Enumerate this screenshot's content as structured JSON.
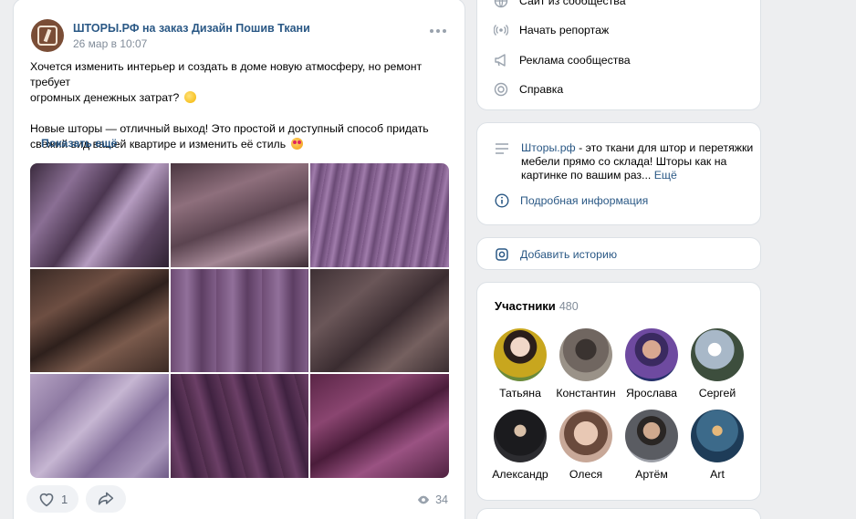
{
  "post": {
    "author": "ШТОРЫ.РФ на заказ Дизайн Пошив Ткани",
    "date": "26 мар в 10:07",
    "text_line1": "Хочется изменить интерьер и создать в доме новую атмосферу, но ремонт требует",
    "text_line2": "огромных денежных затрат?",
    "text_line3": "Новые шторы — отличный выход! Это простой и доступный способ придать",
    "text_line4": "свежий вид вашей квартире и изменить её стиль",
    "show_more": "Показать ещё",
    "photos": [
      "purple satin drape",
      "mauve tulle",
      "crinkled violet fabric",
      "brown silk",
      "lilac curtain folds",
      "taupe crumpled fabric",
      "lavender satin",
      "plum velvet curtain",
      "wine velvet"
    ],
    "likes": "1",
    "views": "34"
  },
  "menu": {
    "items": [
      {
        "label": "Сайт из сообщества",
        "icon": "globe-icon"
      },
      {
        "label": "Начать репортаж",
        "icon": "broadcast-icon"
      },
      {
        "label": "Реклама сообщества",
        "icon": "megaphone-icon"
      },
      {
        "label": "Справка",
        "icon": "help-icon"
      }
    ]
  },
  "description": {
    "link": "Шторы.рф",
    "text": " - это ткани для штор и перетяжки мебели прямо со склада! Шторы как на картинке по вашим раз...",
    "more": "Ещё",
    "details": "Подробная информация"
  },
  "story": {
    "label": "Добавить историю"
  },
  "members": {
    "title": "Участники",
    "count": "480",
    "list": [
      {
        "name": "Татьяна"
      },
      {
        "name": "Константин"
      },
      {
        "name": "Ярослава"
      },
      {
        "name": "Сергей"
      },
      {
        "name": "Александр"
      },
      {
        "name": "Олеся"
      },
      {
        "name": "Артём"
      },
      {
        "name": "Art"
      }
    ]
  },
  "colors": {
    "link": "#2a5885",
    "background": "#edeef0",
    "muted": "#818c99"
  }
}
